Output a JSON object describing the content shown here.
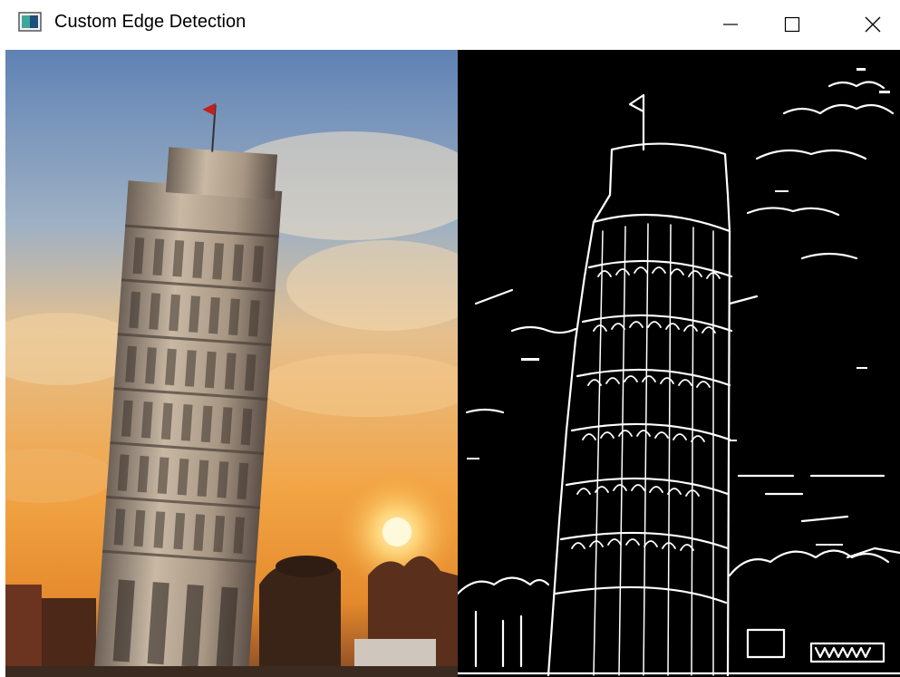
{
  "window": {
    "title": "Custom Edge Detection",
    "icon": "opencv-window-icon",
    "controls": {
      "minimize_icon": "minimize-icon",
      "maximize_icon": "maximize-icon",
      "close_icon": "close-icon"
    }
  },
  "panes": [
    {
      "name": "original-image",
      "content": "photo of leaning tower at sunset"
    },
    {
      "name": "edge-detected-image",
      "content": "white edge map on black background"
    }
  ],
  "colors": {
    "titlebar_bg": "#ffffff",
    "title_text": "#000000",
    "edge_color": "#ffffff",
    "edge_bg": "#000000",
    "sky_top": "#6f8fb8",
    "sky_horizon": "#f0a040",
    "sun": "#fff2b0",
    "tower_stone": "#c9b7a0"
  }
}
